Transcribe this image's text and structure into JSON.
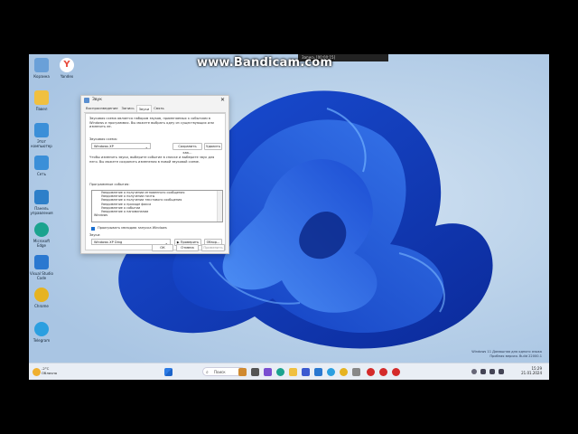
{
  "overlay": {
    "watermark": "www.Bandicam.com",
    "rec_bar": "Запись [00:00:15]"
  },
  "desktop_icons": [
    {
      "label": "Корзина",
      "color": "#6aa0d8"
    },
    {
      "label": "Yandex",
      "color": "#e84a3b"
    },
    {
      "label": "Павел",
      "color": "#f0c040"
    },
    {
      "label": "Этот компьютер",
      "color": "#3b8fd8"
    },
    {
      "label": "Сеть",
      "color": "#3b8fd8"
    },
    {
      "label": "Панель управления",
      "color": "#2d7fc9"
    },
    {
      "label": "Microsoft Edge",
      "color": "#1ba38e"
    },
    {
      "label": "Visual Studio Code",
      "color": "#2a78d0"
    },
    {
      "label": "Chrome",
      "color": "#e6b321"
    },
    {
      "label": "Telegram",
      "color": "#2b9fe0"
    }
  ],
  "dialog": {
    "title": "Звук",
    "close": "✕",
    "tabs": [
      "Воспроизведение",
      "Запись",
      "Звуки",
      "Связь"
    ],
    "intro": "Звуковая схема является набором звуков, применяемых к событиям в Windows и программах. Вы можете выбрать одну из существующих или изменить ее.",
    "scheme_label": "Звуковая схема:",
    "scheme_value": "Windows XP",
    "save_as": "Сохранить как...",
    "delete": "Удалить",
    "hint": "Чтобы изменить звуки, выберите событие в списке и выберите звук для него. Вы можете сохранить изменения в новой звуковой схеме.",
    "events_label": "Программные события:",
    "events": [
      "Уведомление о получении мгновенного сообщения",
      "Уведомление о получении почты",
      "Уведомление о получении текстового сообщения",
      "Уведомление о приходе факса",
      "Уведомление о событии",
      "Уведомление о напоминании",
      "Windows"
    ],
    "startup_check": "Проигрывать мелодию запуска Windows",
    "sounds_label": "Звуки:",
    "sound_value": "Windows XP Ding",
    "test": "▶ Проверить",
    "browse": "Обзор...",
    "ok": "ОК",
    "cancel": "Отмена",
    "apply": "Применить"
  },
  "taskbar": {
    "weather_temp": "-2°C",
    "weather_desc": "Облачно",
    "search": "Поиск",
    "time": "15:29",
    "date": "21.01.2024"
  },
  "activation": {
    "line1": "Windows 11 Домашняя для одного языка",
    "line2": "Пробная версия. Build 22000.1"
  }
}
